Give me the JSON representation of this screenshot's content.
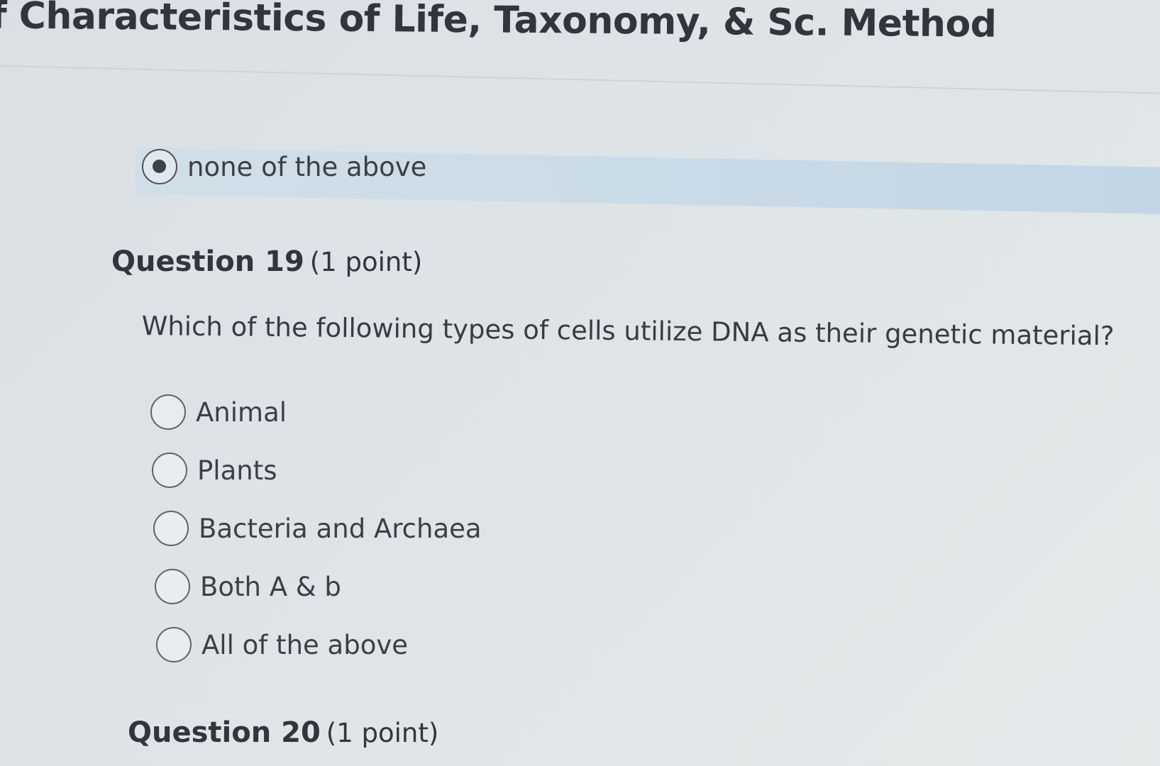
{
  "page": {
    "title": "of Characteristics of Life, Taxonomy, & Sc. Method"
  },
  "previous_question": {
    "selected_option": {
      "label": "none of the above",
      "selected": true
    }
  },
  "question_19": {
    "number_label": "Question 19",
    "points_label": "(1 point)",
    "prompt": "Which of the following types of cells utilize DNA as their genetic material?",
    "options": [
      {
        "label": "Animal",
        "selected": false
      },
      {
        "label": "Plants",
        "selected": false
      },
      {
        "label": "Bacteria and Archaea",
        "selected": false
      },
      {
        "label": "Both A & b",
        "selected": false
      },
      {
        "label": "All of the above",
        "selected": false
      }
    ]
  },
  "question_20": {
    "number_label": "Question 20",
    "points_label": "(1 point)"
  },
  "colors": {
    "background": "#dde3e6",
    "text": "#33393f",
    "highlight": "#c3d8e8",
    "radio_border": "#5d6367"
  }
}
